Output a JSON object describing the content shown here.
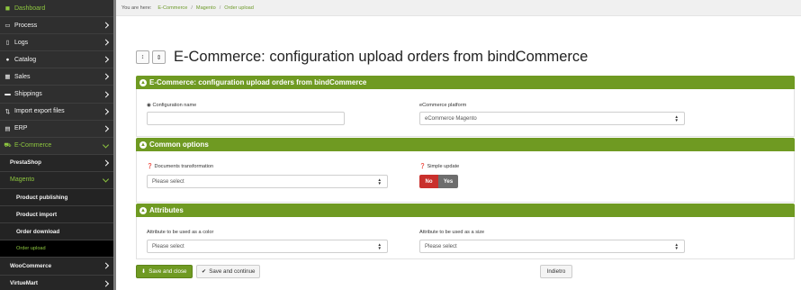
{
  "sidebar": {
    "items": [
      {
        "label": "Dashboard",
        "icon": "dashboard-icon",
        "glyph": "◼"
      },
      {
        "label": "Process",
        "icon": "folder-icon",
        "glyph": "▭"
      },
      {
        "label": "Logs",
        "icon": "file-icon",
        "glyph": "▯"
      },
      {
        "label": "Catalog",
        "icon": "globe-icon",
        "glyph": "●"
      },
      {
        "label": "Sales",
        "icon": "chart-icon",
        "glyph": "▦"
      },
      {
        "label": "Shippings",
        "icon": "truck-icon",
        "glyph": "▬"
      },
      {
        "label": "Import export files",
        "icon": "upload-icon",
        "glyph": "⇅"
      },
      {
        "label": "ERP",
        "icon": "server-icon",
        "glyph": "▤"
      },
      {
        "label": "E-Commerce",
        "icon": "cart-icon",
        "glyph": "⛟"
      },
      {
        "label": "PrestaShop"
      },
      {
        "label": "Magento"
      },
      {
        "label": "Product publishing"
      },
      {
        "label": "Product import"
      },
      {
        "label": "Order download"
      },
      {
        "label": "Order upload"
      },
      {
        "label": "WooCommerce"
      },
      {
        "label": "VirtueMart"
      }
    ]
  },
  "breadcrumb": {
    "prefix": "You are here:",
    "items": [
      "E-Commerce",
      "Magento",
      "Order upload"
    ]
  },
  "header": {
    "title": "E-Commerce: configuration upload orders from bindCommerce"
  },
  "panels": {
    "config": {
      "title": "E-Commerce: configuration upload orders from bindCommerce",
      "name_label": "Configuration name",
      "name_value": "",
      "platform_label": "eCommerce platform",
      "platform_value": "eCommerce Magento"
    },
    "common": {
      "title": "Common options",
      "docs_label": "Documents transformation",
      "docs_value": "Please select",
      "simple_label": "Simple update",
      "no_label": "No",
      "yes_label": "Yes"
    },
    "attributes": {
      "title": "Attributes",
      "color_label": "Attribute to be used as a color",
      "color_value": "Please select",
      "size_label": "Attribute to be used as a size",
      "size_value": "Please select"
    }
  },
  "footer": {
    "save_close": "Save and close",
    "save_continue": "Save and continue",
    "back": "Indietro"
  },
  "colors": {
    "accent_green": "#6f9a22",
    "sidebar_bg": "#2f2f2f",
    "danger": "#c9302c"
  }
}
